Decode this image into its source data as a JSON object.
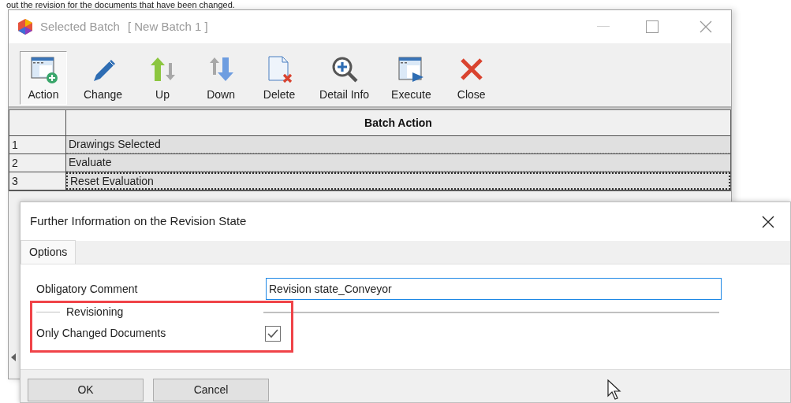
{
  "caption": "out the revision for the documents that have been changed.",
  "window": {
    "title": "Selected Batch",
    "subtitle": "[ New Batch 1 ]"
  },
  "toolbar": [
    {
      "label": "Action",
      "kind": "action",
      "selected": true
    },
    {
      "label": "Change",
      "kind": "change",
      "selected": false
    },
    {
      "label": "Up",
      "kind": "up",
      "selected": false
    },
    {
      "label": "Down",
      "kind": "down",
      "selected": false
    },
    {
      "label": "Delete",
      "kind": "delete",
      "selected": false
    },
    {
      "label": "Detail Info",
      "kind": "detail",
      "selected": false
    },
    {
      "label": "Execute",
      "kind": "execute",
      "selected": false
    },
    {
      "label": "Close",
      "kind": "close",
      "selected": false
    }
  ],
  "grid": {
    "columns": [
      "Batch Action"
    ],
    "rows": [
      {
        "index": "1",
        "action": "Drawings Selected",
        "selected": false
      },
      {
        "index": "2",
        "action": "Evaluate",
        "selected": false
      },
      {
        "index": "3",
        "action": "Reset Evaluation",
        "selected": true
      }
    ]
  },
  "dialog": {
    "title": "Further Information on the Revision State",
    "tabs": [
      {
        "label": "Options",
        "selected": true
      }
    ],
    "field": {
      "label": "Obligatory Comment",
      "value": "Revision state_Conveyor"
    },
    "group": {
      "title": "Revisioning"
    },
    "checkbox": {
      "label": "Only Changed Documents",
      "checked": true
    },
    "buttons": [
      "OK",
      "Cancel"
    ]
  }
}
